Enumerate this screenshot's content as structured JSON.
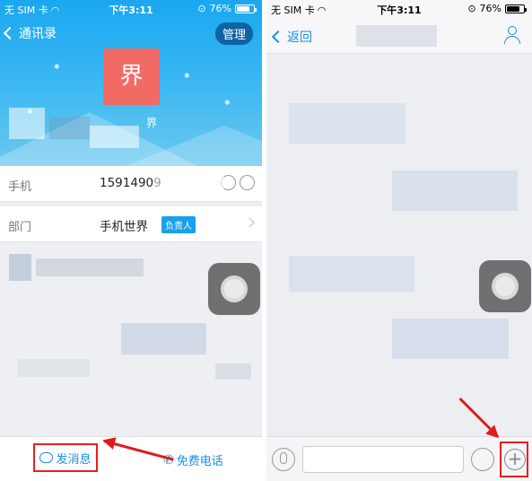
{
  "left": {
    "statusbar": {
      "carrier": "无 SIM 卡",
      "time": "下午3:11",
      "battery": "76%",
      "battery_level": 0.76
    },
    "header": {
      "back_label": "通讯录",
      "manage_label": "管理",
      "avatar_char": "界",
      "name_fragment": "界"
    },
    "rows": {
      "phone": {
        "label": "手机",
        "value": "15914909"
      },
      "dept": {
        "label": "部门",
        "value": "手机世界",
        "badge": "负责人"
      }
    },
    "bottom": {
      "send_message": "发消息",
      "free_call": "免费电话"
    }
  },
  "right": {
    "statusbar": {
      "carrier": "无 SIM 卡",
      "time": "下午3:11",
      "battery": "76%",
      "battery_level": 0.76
    },
    "nav": {
      "back_label": "返回"
    },
    "bottom": {
      "plus_symbol": "+"
    }
  },
  "colors": {
    "accent": "#1a8fe8",
    "highlight": "#e81f1f",
    "avatar": "#f16a64",
    "header_top": "#1aa7f0"
  }
}
